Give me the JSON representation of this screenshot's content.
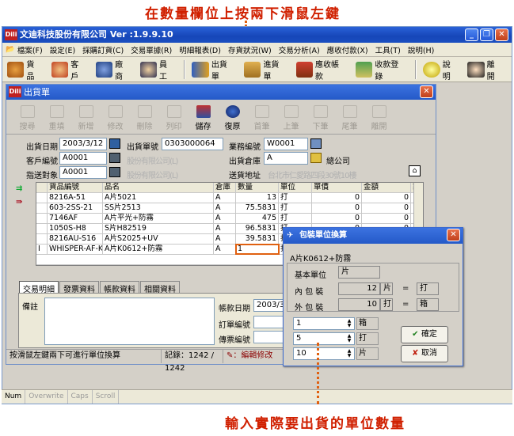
{
  "annotation_top": "在數量欄位上按兩下滑鼠左鍵",
  "annotation_bottom": "輸入實際要出貨的單位數量",
  "app": {
    "title": "文迪科技股份有限公司 Ver :1.9.9.10",
    "logo": "Dili"
  },
  "menu": [
    "檔案(F)",
    "設定(E)",
    "採購訂貨(C)",
    "交易單據(R)",
    "明細報表(D)",
    "存貨狀況(W)",
    "交易分析(A)",
    "應收付款(X)",
    "工具(T)",
    "說明(H)"
  ],
  "toolbar": {
    "goods": "貨品",
    "customer": "客戶",
    "vendor": "廠商",
    "staff": "員工",
    "ship": "出貨單",
    "receive": "進貨單",
    "ar": "應收帳款",
    "collect": "收款登錄",
    "help": "說明",
    "exit": "離開"
  },
  "child": {
    "title": "出貨單",
    "buttons": [
      "搜尋",
      "重填",
      "新增",
      "修改",
      "刪除",
      "列印",
      "儲存",
      "復原",
      "首筆",
      "上筆",
      "下筆",
      "尾筆",
      "離開"
    ],
    "date_label": "出貨日期",
    "date": "2003/3/12",
    "no_label": "出貨單號",
    "no": "0303000064",
    "sales_label": "業務編號",
    "sales": "W0001",
    "cust_label": "客戶編號",
    "cust": "A0001",
    "cust_name": "股份有限公司(L)",
    "wh_label": "出貨倉庫",
    "wh": "A",
    "wh_name": "總公司",
    "target_label": "指送對象",
    "target": "A0001",
    "target_name": "股份有限公司(L)",
    "addr_label": "送貨地址",
    "addr": "台北市仁愛路四段30號10樓",
    "grid_head": [
      "貨品編號",
      "品名",
      "倉庫",
      "數量",
      "單位",
      "單價",
      "金額",
      "訂"
    ],
    "rows": [
      [
        "8216A-51",
        "A片5021",
        "A",
        "13",
        "打",
        "0",
        "0"
      ],
      [
        "603-2SS-21",
        "SS片2513",
        "A",
        "75.5831",
        "打",
        "0",
        "0"
      ],
      [
        "7146AF",
        "A片平光+防霧",
        "A",
        "475",
        "打",
        "0",
        "0"
      ],
      [
        "1050S-H8",
        "S片H82519",
        "A",
        "96.5831",
        "打",
        "0",
        "0"
      ],
      [
        "8216AU-S16",
        "A片S2025+UV",
        "A",
        "39.5831",
        "打",
        "0",
        "0"
      ],
      [
        "WHISPER-AF-K1",
        "A片K0612+防霧",
        "A",
        "1",
        "打",
        "",
        ""
      ]
    ],
    "tabs": [
      "交易明細",
      "發票資料",
      "帳款資料",
      "相關資料"
    ],
    "memo_label": "備註",
    "pay_date_label": "帳款日期",
    "pay_date": "2003/3/1",
    "order_label": "訂單編號",
    "send_label": "傳票編號",
    "status_hint": "按滑鼠左鍵兩下可進行單位換算",
    "status_rec": "記錄：1242 / 1242",
    "status_mode": "：編輯修改"
  },
  "dialog": {
    "title": "包裝單位換算",
    "product": "A片K0612+防霧",
    "base_label": "基本單位",
    "base": "片",
    "inner_label": "內 包 裝",
    "inner_qty": "12",
    "inner_u1": "片",
    "inner_u2": "打",
    "outer_label": "外 包 裝",
    "outer_qty": "10",
    "outer_u1": "打",
    "outer_u2": "箱",
    "eq": "=",
    "in1": "1",
    "in1_u": "箱",
    "in2": "5",
    "in2_u": "打",
    "in3": "10",
    "in3_u": "片",
    "ok": "確定",
    "cancel": "取消"
  },
  "bottom_status": [
    "Num",
    "Overwrite",
    "Caps",
    "Scroll"
  ]
}
